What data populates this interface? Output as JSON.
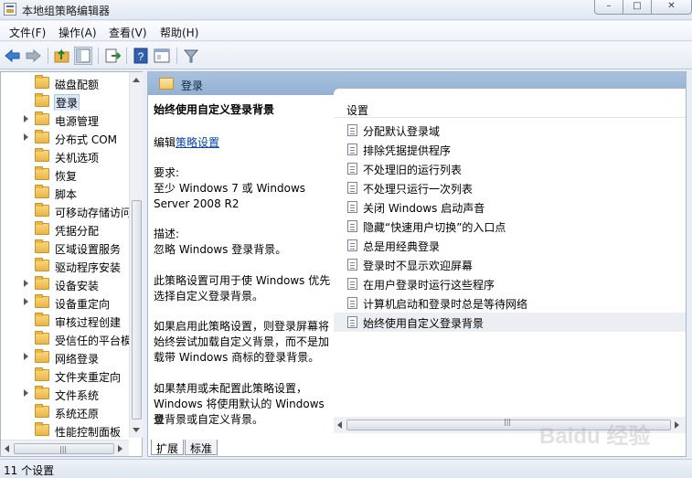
{
  "window": {
    "title": "本地组策略编辑器"
  },
  "menu": [
    "文件(F)",
    "操作(A)",
    "查看(V)",
    "帮助(H)"
  ],
  "toolbar": {
    "buttons": [
      "back-icon",
      "forward-icon",
      "up-folder-icon",
      "show-hide-tree-icon",
      "export-list-icon",
      "help-icon",
      "properties-icon",
      "filter-icon"
    ]
  },
  "tree": {
    "items": [
      {
        "label": "磁盘配额",
        "expandable": false
      },
      {
        "label": "登录",
        "expandable": false,
        "selected": true
      },
      {
        "label": "电源管理",
        "expandable": true
      },
      {
        "label": "分布式 COM",
        "expandable": true
      },
      {
        "label": "关机选项",
        "expandable": false
      },
      {
        "label": "恢复",
        "expandable": false
      },
      {
        "label": "脚本",
        "expandable": false
      },
      {
        "label": "可移动存储访问",
        "expandable": false
      },
      {
        "label": "凭据分配",
        "expandable": false
      },
      {
        "label": "区域设置服务",
        "expandable": false
      },
      {
        "label": "驱动程序安装",
        "expandable": false
      },
      {
        "label": "设备安装",
        "expandable": true
      },
      {
        "label": "设备重定向",
        "expandable": true
      },
      {
        "label": "审核过程创建",
        "expandable": false
      },
      {
        "label": "受信任的平台模",
        "expandable": false
      },
      {
        "label": "网络登录",
        "expandable": true
      },
      {
        "label": "文件夹重定向",
        "expandable": false
      },
      {
        "label": "文件系统",
        "expandable": true
      },
      {
        "label": "系统还原",
        "expandable": false
      },
      {
        "label": "性能控制面板",
        "expandable": false
      }
    ]
  },
  "right_pane": {
    "header_title": "登录",
    "description": {
      "heading": "始终使用自定义登录背景",
      "edit_prefix": "编辑",
      "edit_link": "策略设置",
      "requirements_label": "要求:",
      "requirements_line1": "至少 Windows 7 或 Windows",
      "requirements_line2": "Server 2008 R2",
      "desc_label": "描述:",
      "desc_text": "忽略 Windows 登录背景。",
      "para1_line1": "此策略设置可用于使 Windows 优先",
      "para1_line2": "选择自定义登录背景。",
      "para2_line1": "如果启用此策略设置，则登录屏幕将",
      "para2_line2": "始终尝试加载自定义背景，而不是加",
      "para2_line3": "载带 Windows 商标的登录背景。",
      "para3_line1": "如果禁用或未配置此策略设置，",
      "para3_line2": "Windows 将使用默认的 Windows 登",
      "para3_line3": "录背景或自定义背景。"
    },
    "column_header": "设置",
    "settings": [
      "分配默认登录域",
      "排除凭据提供程序",
      "不处理旧的运行列表",
      "不处理只运行一次列表",
      "关闭 Windows 启动声音",
      "隐藏“快速用户切换”的入口点",
      "总是用经典登录",
      "登录时不显示欢迎屏幕",
      "在用户登录时运行这些程序",
      "计算机启动和登录时总是等待网络",
      "始终使用自定义登录背景"
    ],
    "selected_setting_index": 10,
    "tabs": [
      "扩展",
      "标准"
    ],
    "active_tab": "扩展"
  },
  "status": {
    "text": "11 个设置"
  },
  "watermark": {
    "text": "Baidu 经验"
  }
}
